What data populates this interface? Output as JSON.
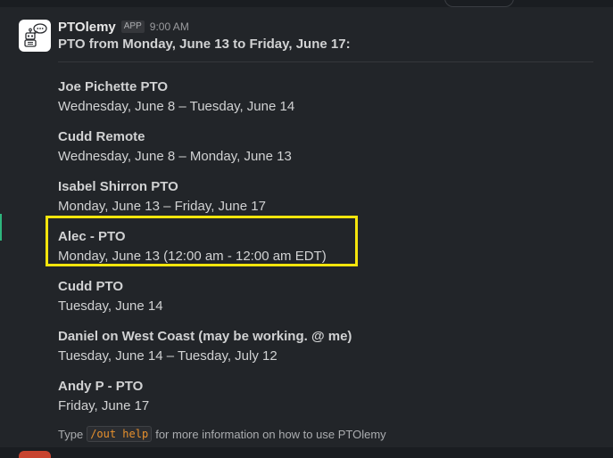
{
  "message": {
    "app_name": "PTOlemy",
    "badge": "APP",
    "time": "9:00 AM",
    "title": "PTO from Monday, June 13 to Friday, June 17:",
    "entries": [
      {
        "name": "Joe Pichette PTO",
        "dates": "Wednesday, June 8 – Tuesday, June 14"
      },
      {
        "name": "Cudd Remote",
        "dates": "Wednesday, June 8 – Monday, June 13"
      },
      {
        "name": "Isabel Shirron PTO",
        "dates": "Monday, June 13 – Friday, June 17"
      },
      {
        "name": "Alec - PTO",
        "dates": "Monday, June 13 (12:00 am - 12:00 am EDT)"
      },
      {
        "name": "Cudd PTO",
        "dates": "Tuesday, June 14"
      },
      {
        "name": "Daniel on West Coast (may be working. @ me)",
        "dates": "Tuesday, June 14 – Tuesday, July 12"
      },
      {
        "name": "Andy P - PTO",
        "dates": "Friday, June 17"
      }
    ],
    "footer": {
      "prefix": "Type",
      "command": "/out help",
      "suffix": "for more information on how to use PTOlemy"
    }
  },
  "icons": {
    "avatar": "robot-icon"
  },
  "colors": {
    "background": "#1a1d21",
    "message_hover": "#222529",
    "highlight": "#f5e50c",
    "code": "#e8912d"
  }
}
